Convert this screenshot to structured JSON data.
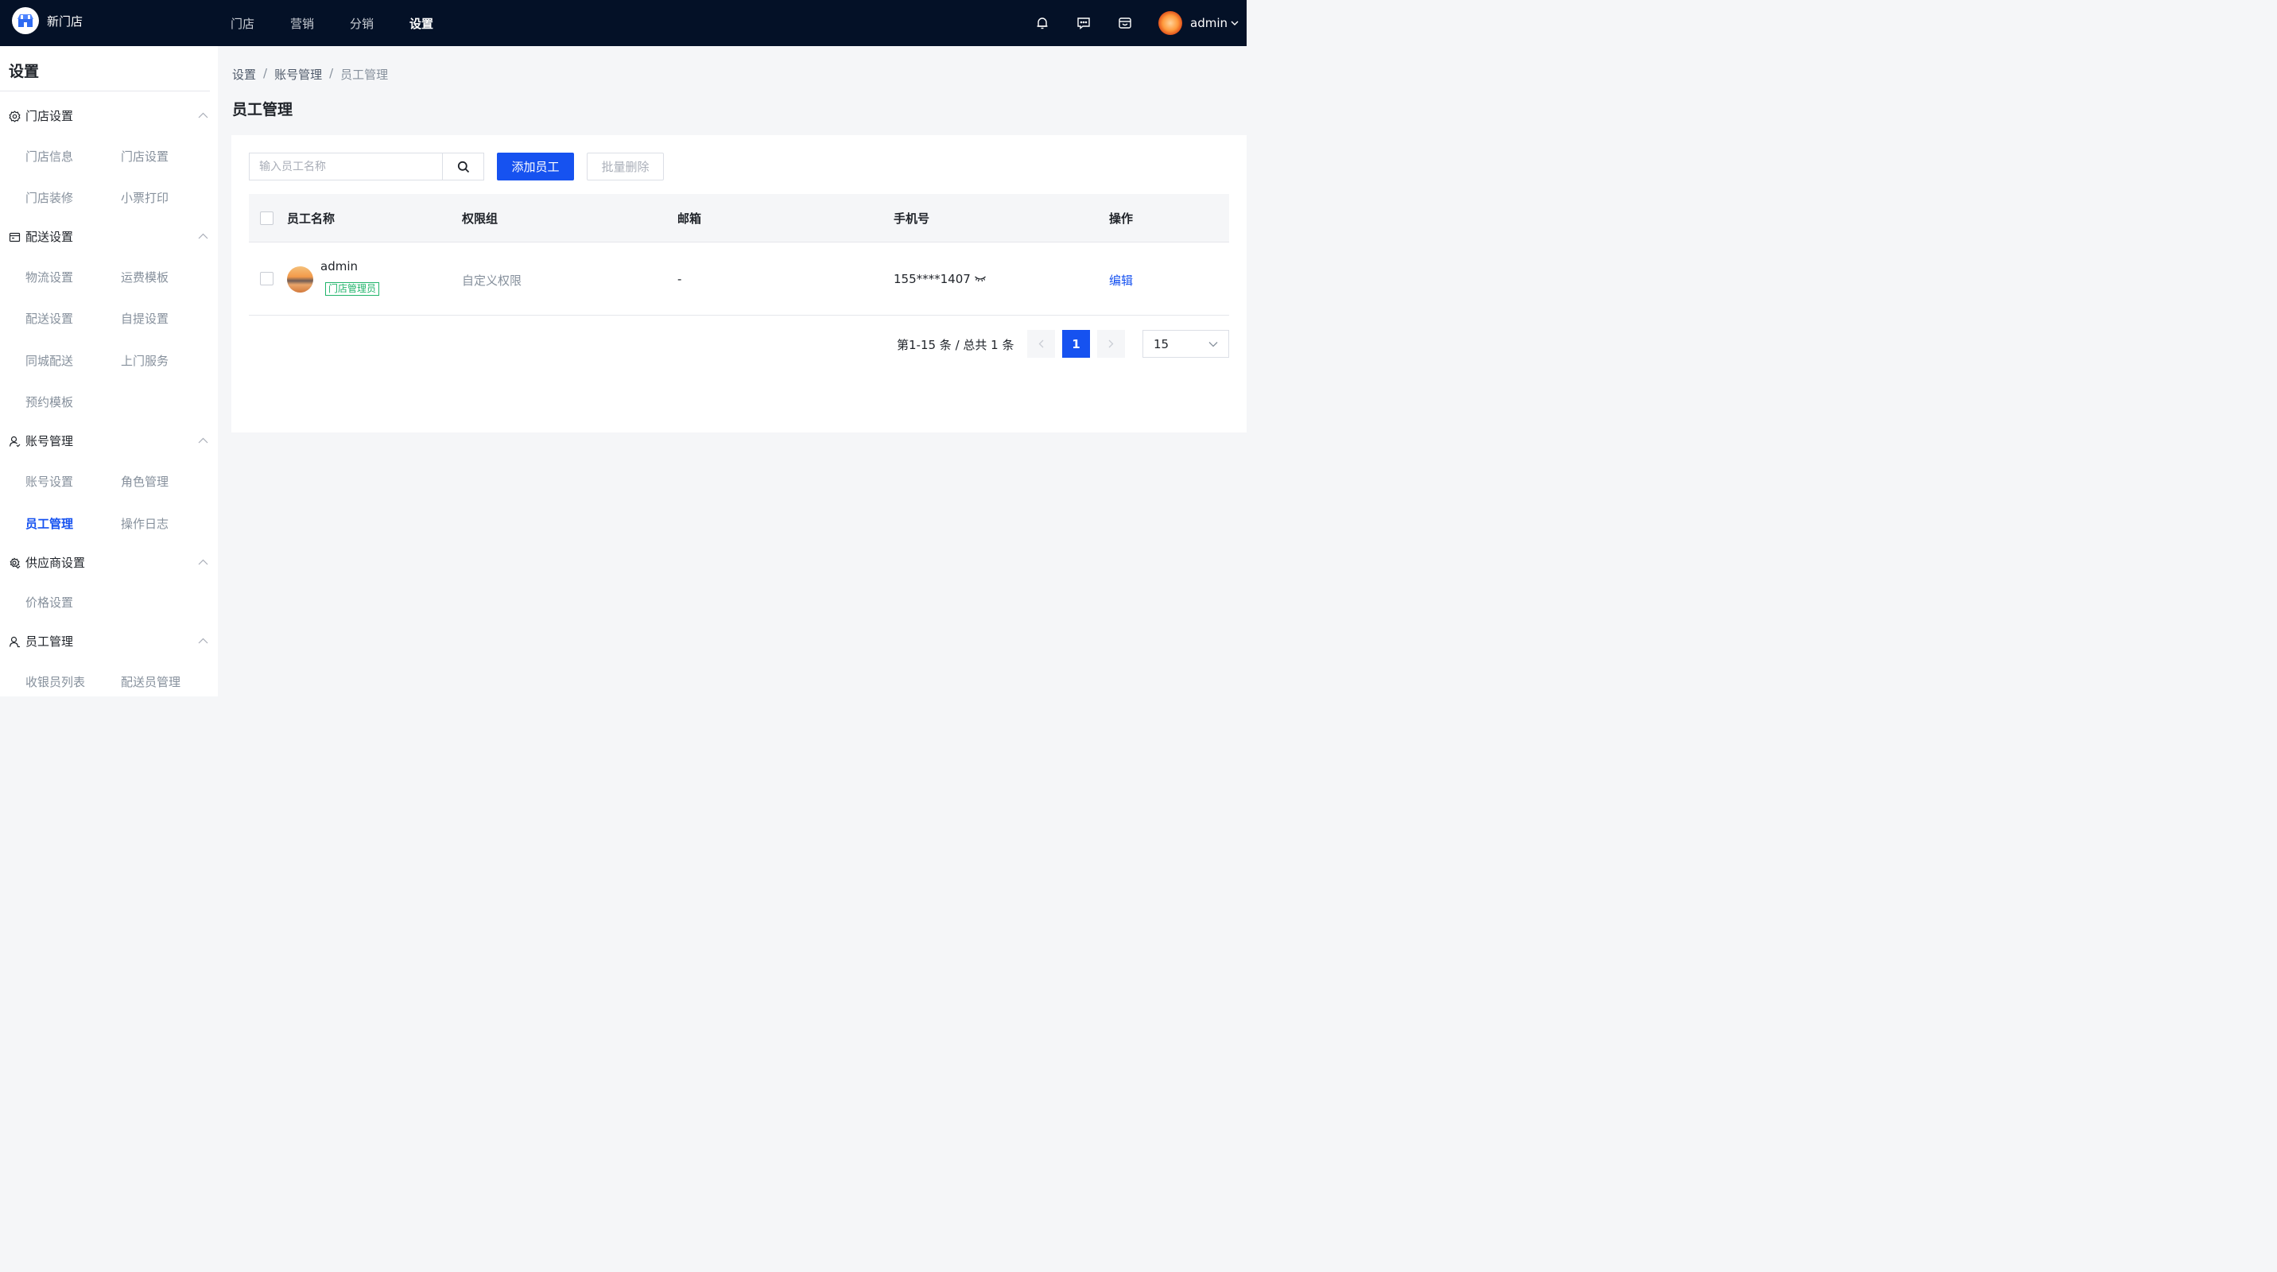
{
  "app": {
    "store_name": "新门店"
  },
  "topnav": {
    "items": [
      {
        "label": "门店"
      },
      {
        "label": "营销"
      },
      {
        "label": "分销"
      },
      {
        "label": "设置",
        "active": true
      }
    ]
  },
  "user": {
    "name": "admin"
  },
  "sidebar": {
    "title": "设置",
    "groups": [
      {
        "label": "门店设置",
        "items": [
          "门店信息",
          "门店设置",
          "门店装修",
          "小票打印"
        ]
      },
      {
        "label": "配送设置",
        "items": [
          "物流设置",
          "运费模板",
          "配送设置",
          "自提设置",
          "同城配送",
          "上门服务",
          "预约模板"
        ]
      },
      {
        "label": "账号管理",
        "items": [
          "账号设置",
          "角色管理",
          "员工管理",
          "操作日志"
        ],
        "active_item": "员工管理"
      },
      {
        "label": "供应商设置",
        "items": [
          "价格设置"
        ]
      },
      {
        "label": "员工管理",
        "items": [
          "收银员列表",
          "配送员管理"
        ]
      }
    ]
  },
  "breadcrumb": [
    "设置",
    "账号管理",
    "员工管理"
  ],
  "page": {
    "title": "员工管理"
  },
  "toolbar": {
    "search_placeholder": "输入员工名称",
    "add_label": "添加员工",
    "batch_delete_label": "批量删除"
  },
  "table": {
    "columns": [
      "员工名称",
      "权限组",
      "邮箱",
      "手机号",
      "操作"
    ],
    "rows": [
      {
        "name": "admin",
        "tag": "门店管理员",
        "group": "自定义权限",
        "email": "-",
        "phone": "155****1407",
        "action": "编辑"
      }
    ]
  },
  "pagination": {
    "summary": "第1-15 条 / 总共 1 条",
    "current": "1",
    "page_size": "15"
  },
  "colors": {
    "topbar": "#041127",
    "primary": "#1652f0",
    "tag": "#20b46a"
  }
}
